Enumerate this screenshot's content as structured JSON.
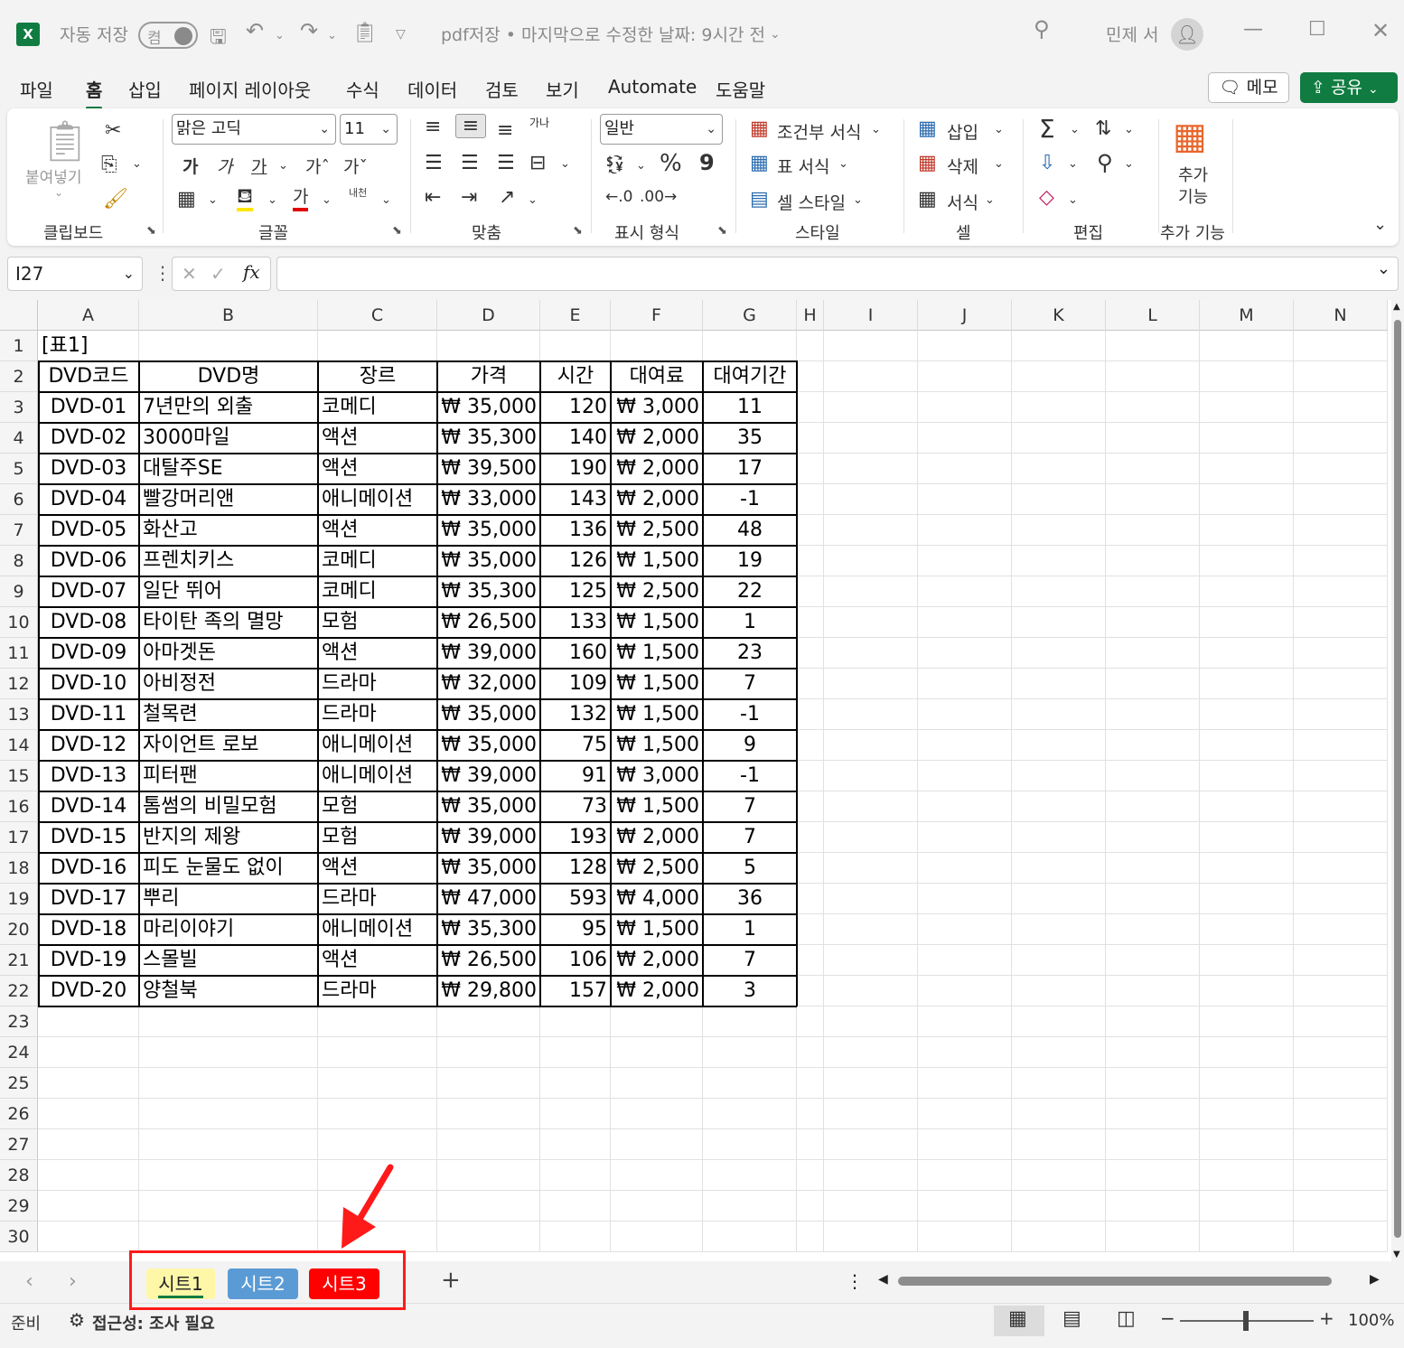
{
  "titlebar": {
    "autosave_label": "자동 저장",
    "autosave_state": "켬",
    "doc_title": "pdf저장 • 마지막으로 수정한 날짜: 9시간 전",
    "user_name": "민제 서"
  },
  "menu": {
    "tabs": [
      "파일",
      "홈",
      "삽입",
      "페이지 레이아웃",
      "수식",
      "데이터",
      "검토",
      "보기",
      "Automate",
      "도움말"
    ],
    "memo_label": "메모",
    "share_label": "공유"
  },
  "ribbon": {
    "clipboard": {
      "paste_label": "붙여넣기",
      "group_label": "클립보드"
    },
    "font": {
      "font_name": "맑은 고딕",
      "font_size": "11",
      "bold": "가",
      "italic": "가",
      "underline": "가",
      "grow": "가ˆ",
      "shrink": "가ˇ",
      "font_color_glyph": "가",
      "phonetic": "내천",
      "group_label": "글꼴"
    },
    "alignment": {
      "wrap_glyph": "가나",
      "group_label": "맞춤"
    },
    "number": {
      "format": "일반",
      "percent": "%",
      "comma": "9",
      "group_label": "표시 형식"
    },
    "styles": {
      "conditional": "조건부 서식",
      "table": "표 서식",
      "cell_style": "셀 스타일",
      "group_label": "스타일"
    },
    "cells": {
      "insert": "삽입",
      "delete": "삭제",
      "format": "서식",
      "group_label": "셀"
    },
    "editing": {
      "group_label": "편집"
    },
    "addins": {
      "label_line1": "추가",
      "label_line2": "기능",
      "group_label": "추가 기능"
    }
  },
  "formula_bar": {
    "name_box": "I27",
    "fx": "fx",
    "formula": ""
  },
  "grid": {
    "columns": [
      "A",
      "B",
      "C",
      "D",
      "E",
      "F",
      "G",
      "H",
      "I",
      "J",
      "K",
      "L",
      "M",
      "N"
    ],
    "rows": [
      "1",
      "2",
      "3",
      "4",
      "5",
      "6",
      "7",
      "8",
      "9",
      "10",
      "11",
      "12",
      "13",
      "14",
      "15",
      "16",
      "17",
      "18",
      "19",
      "20",
      "21",
      "22",
      "23",
      "24",
      "25",
      "26",
      "27",
      "28",
      "29",
      "30"
    ],
    "table_label": "[표1]",
    "headers": [
      "DVD코드",
      "DVD명",
      "장르",
      "가격",
      "시간",
      "대여료",
      "대여기간"
    ],
    "data": [
      [
        "DVD-01",
        "7년만의 외출",
        "코메디",
        "₩ 35,000",
        "120",
        "₩ 3,000",
        "11"
      ],
      [
        "DVD-02",
        "3000마일",
        "액션",
        "₩ 35,300",
        "140",
        "₩ 2,000",
        "35"
      ],
      [
        "DVD-03",
        "대탈주SE",
        "액션",
        "₩ 39,500",
        "190",
        "₩ 2,000",
        "17"
      ],
      [
        "DVD-04",
        "빨강머리앤",
        "애니메이션",
        "₩ 33,000",
        "143",
        "₩ 2,000",
        "-1"
      ],
      [
        "DVD-05",
        "화산고",
        "액션",
        "₩ 35,000",
        "136",
        "₩ 2,500",
        "48"
      ],
      [
        "DVD-06",
        "프렌치키스",
        "코메디",
        "₩ 35,000",
        "126",
        "₩ 1,500",
        "19"
      ],
      [
        "DVD-07",
        "일단 뛰어",
        "코메디",
        "₩ 35,300",
        "125",
        "₩ 2,500",
        "22"
      ],
      [
        "DVD-08",
        "타이탄 족의 멸망",
        "모험",
        "₩ 26,500",
        "133",
        "₩ 1,500",
        "1"
      ],
      [
        "DVD-09",
        "아마겟돈",
        "액션",
        "₩ 39,000",
        "160",
        "₩ 1,500",
        "23"
      ],
      [
        "DVD-10",
        "아비정전",
        "드라마",
        "₩ 32,000",
        "109",
        "₩ 1,500",
        "7"
      ],
      [
        "DVD-11",
        "철목련",
        "드라마",
        "₩ 35,000",
        "132",
        "₩ 1,500",
        "-1"
      ],
      [
        "DVD-12",
        "자이언트 로보",
        "애니메이션",
        "₩ 35,000",
        "75",
        "₩ 1,500",
        "9"
      ],
      [
        "DVD-13",
        "피터팬",
        "애니메이션",
        "₩ 39,000",
        "91",
        "₩ 3,000",
        "-1"
      ],
      [
        "DVD-14",
        "톰썸의 비밀모험",
        "모험",
        "₩ 35,000",
        "73",
        "₩ 1,500",
        "7"
      ],
      [
        "DVD-15",
        "반지의 제왕",
        "모험",
        "₩ 39,000",
        "193",
        "₩ 2,000",
        "7"
      ],
      [
        "DVD-16",
        "피도 눈물도 없이",
        "액션",
        "₩ 35,000",
        "128",
        "₩ 2,500",
        "5"
      ],
      [
        "DVD-17",
        "뿌리",
        "드라마",
        "₩ 47,000",
        "593",
        "₩ 4,000",
        "36"
      ],
      [
        "DVD-18",
        "마리이야기",
        "애니메이션",
        "₩ 35,300",
        "95",
        "₩ 1,500",
        "1"
      ],
      [
        "DVD-19",
        "스몰빌",
        "액션",
        "₩ 26,500",
        "106",
        "₩ 2,000",
        "7"
      ],
      [
        "DVD-20",
        "양철북",
        "드라마",
        "₩ 29,800",
        "157",
        "₩ 2,000",
        "3"
      ]
    ]
  },
  "sheets": [
    {
      "name": "시트1",
      "bg": "#fff7a8",
      "fg": "#222"
    },
    {
      "name": "시트2",
      "bg": "#5b9bd5",
      "fg": "#ffffff"
    },
    {
      "name": "시트3",
      "bg": "#ff0000",
      "fg": "#ffffff"
    }
  ],
  "statusbar": {
    "ready": "준비",
    "accessibility": "접근성: 조사 필요",
    "zoom": "100%"
  },
  "colors": {
    "accent": "#107c41",
    "annotation": "#ff1a1a"
  }
}
